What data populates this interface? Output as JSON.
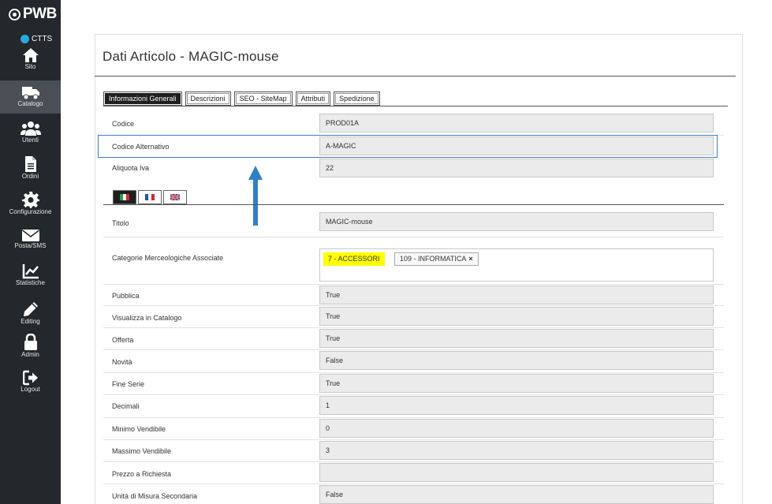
{
  "sidebar": {
    "brand": "PWB",
    "site_badge": "CTTS",
    "items": [
      {
        "label": "Sito",
        "icon": "home-icon"
      },
      {
        "label": "Catalogo",
        "icon": "truck-icon"
      },
      {
        "label": "Utenti",
        "icon": "users-icon"
      },
      {
        "label": "Ordini",
        "icon": "document-icon"
      },
      {
        "label": "Configurazione",
        "icon": "gear-icon"
      },
      {
        "label": "Posta/SMS",
        "icon": "envelope-icon"
      },
      {
        "label": "Statistiche",
        "icon": "chart-icon"
      },
      {
        "label": "Editing",
        "icon": "pencil-icon"
      },
      {
        "label": "Admin",
        "icon": "lock-icon"
      },
      {
        "label": "Logout",
        "icon": "logout-icon"
      }
    ],
    "active": "Catalogo"
  },
  "page": {
    "title": "Dati Articolo - MAGIC-mouse"
  },
  "tabs": [
    {
      "label": "Informazioni Generali",
      "active": true
    },
    {
      "label": "Descrizioni",
      "active": false
    },
    {
      "label": "SEO - SiteMap",
      "active": false
    },
    {
      "label": "Attributi",
      "active": false
    },
    {
      "label": "Spedizione",
      "active": false
    }
  ],
  "general_fields": [
    {
      "label": "Codice",
      "value": "PROD01A"
    },
    {
      "label": "Codice Alternativo",
      "value": "A-MAGIC"
    },
    {
      "label": "Aliquota Iva",
      "value": "22"
    }
  ],
  "languages": [
    "it",
    "fr",
    "gb"
  ],
  "titolo": {
    "label": "Titolo",
    "value": "MAGIC-mouse"
  },
  "categorie": {
    "label": "Categorie Merceologiche Associate",
    "primary": "7 - ACCESSORI",
    "tags": [
      "109 - INFORMATICA"
    ],
    "remove_symbol": "×"
  },
  "fields": [
    {
      "label": "Pubblica",
      "value": "True"
    },
    {
      "label": "Visualizza in Catalogo",
      "value": "True"
    },
    {
      "label": "Offerta",
      "value": "True"
    },
    {
      "label": "Novità",
      "value": "False"
    },
    {
      "label": "Fine Serie",
      "value": "True"
    },
    {
      "label": "Decimali",
      "value": "1"
    },
    {
      "label": "Minimo Vendibile",
      "value": "0"
    },
    {
      "label": "Massimo Vendibile",
      "value": "3"
    },
    {
      "label": "Prezzo a Richiesta",
      "value": ""
    },
    {
      "label": "Unità di Misura Secondaria",
      "value": "False"
    }
  ],
  "colors": {
    "sidebar_bg": "#24272b",
    "accent_blue": "#2f80c7",
    "highlight_yellow": "#ffff00"
  }
}
